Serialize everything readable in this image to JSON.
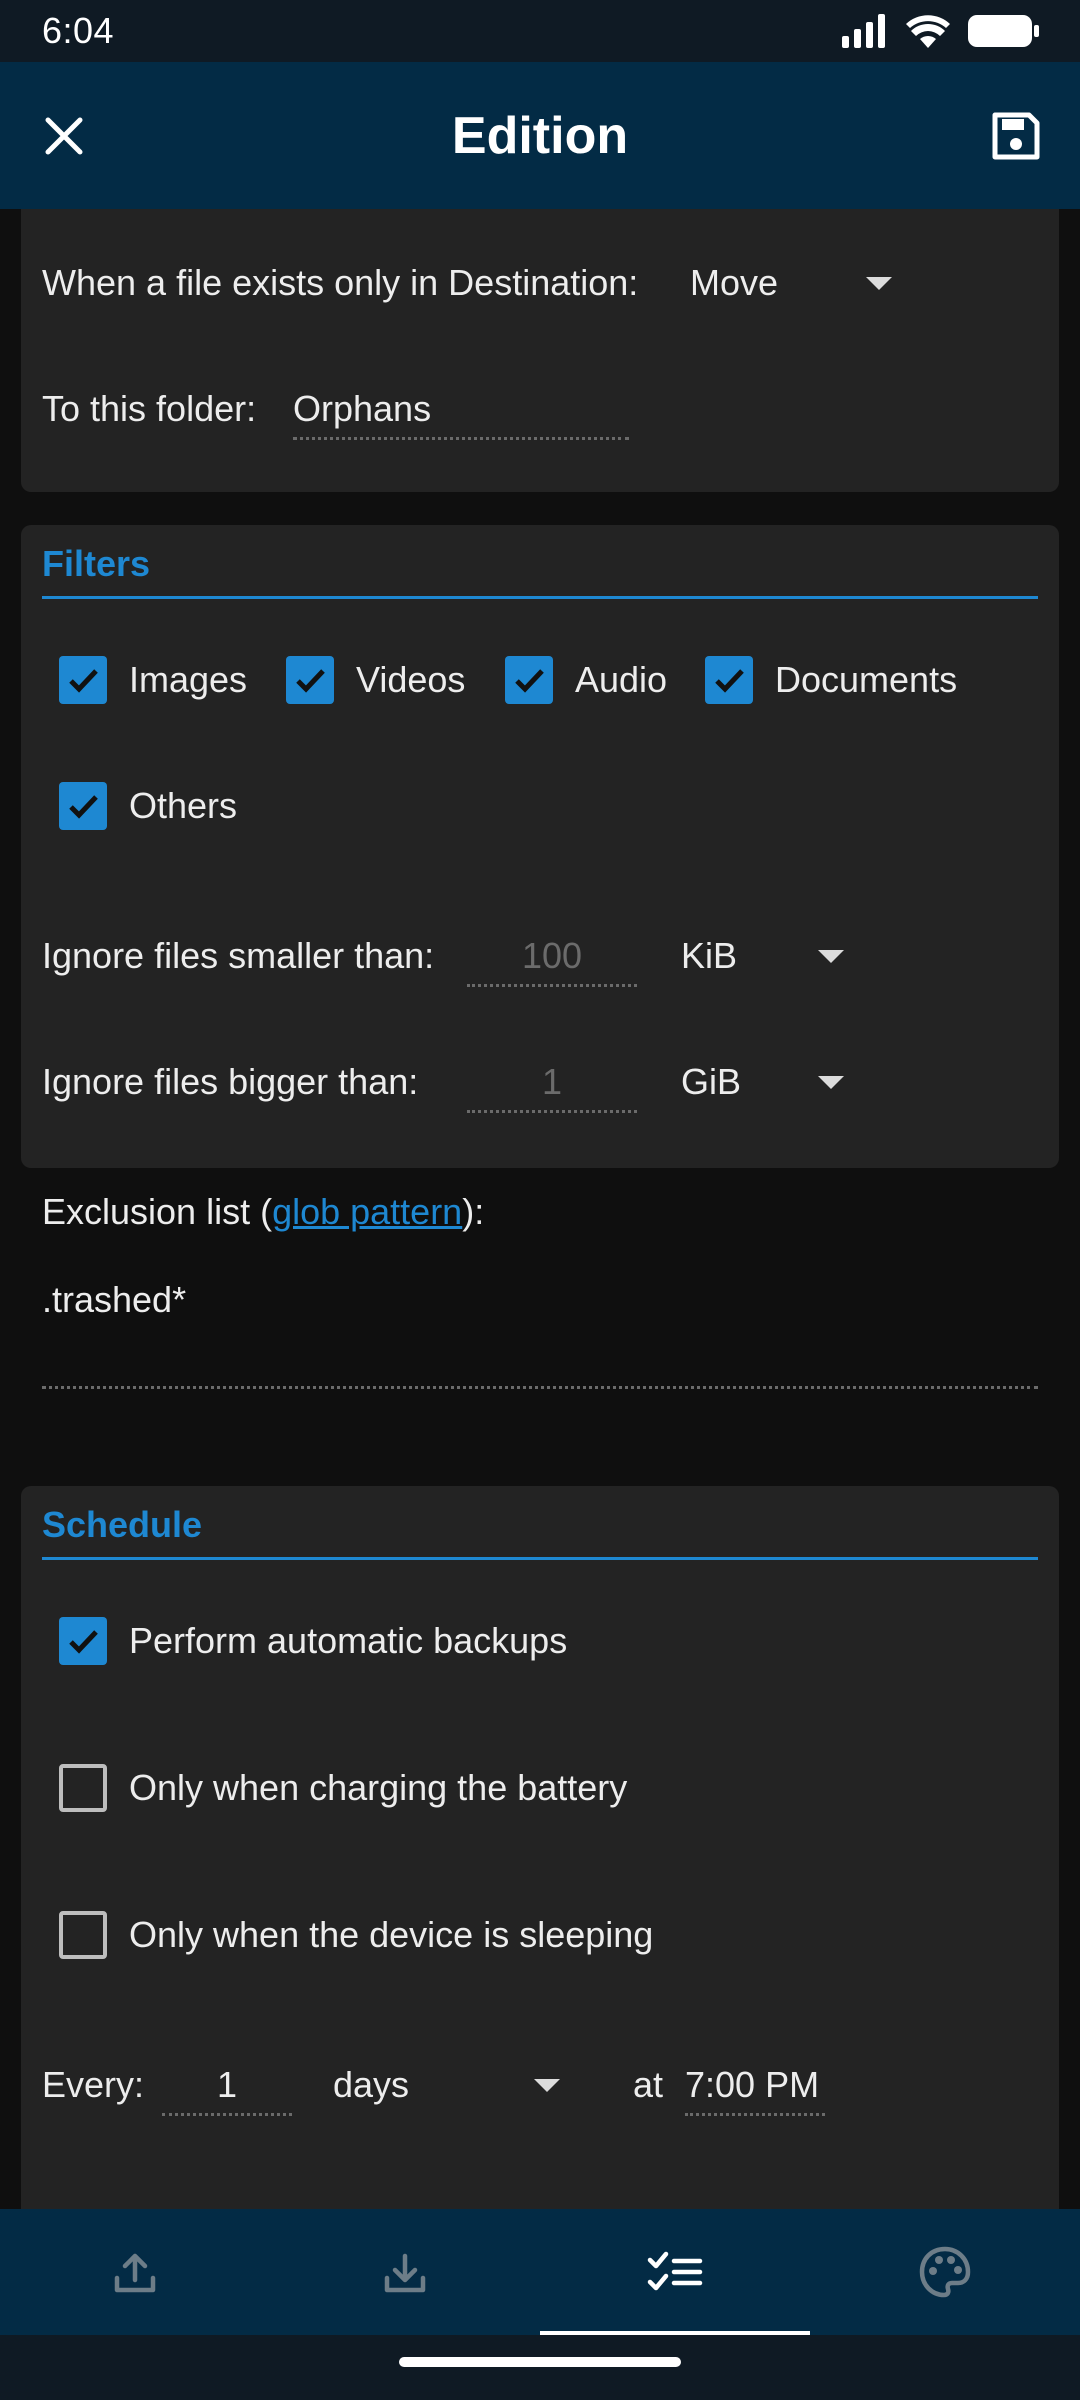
{
  "status_bar": {
    "time": "6:04"
  },
  "app_bar": {
    "title": "Edition"
  },
  "sync_section": {
    "dest_only_label": "When a file exists only in Destination:",
    "dest_only_value": "Move",
    "folder_label": "To this folder:",
    "folder_value": "Orphans"
  },
  "filters": {
    "title": "Filters",
    "types": [
      {
        "label": "Images",
        "checked": true
      },
      {
        "label": "Videos",
        "checked": true
      },
      {
        "label": "Audio",
        "checked": true
      },
      {
        "label": "Documents",
        "checked": true
      },
      {
        "label": "Others",
        "checked": true
      }
    ],
    "smaller_label": "Ignore files smaller than:",
    "smaller_value": "100",
    "smaller_unit": "KiB",
    "bigger_label": "Ignore files bigger than:",
    "bigger_value": "1",
    "bigger_unit": "GiB",
    "exclusion_prefix": "Exclusion list (",
    "exclusion_link": "glob pattern",
    "exclusion_suffix": "):",
    "exclusion_value": ".trashed*"
  },
  "schedule": {
    "title": "Schedule",
    "auto_backup": {
      "label": "Perform automatic backups",
      "checked": true
    },
    "charging": {
      "label": "Only when charging the battery",
      "checked": false
    },
    "sleeping": {
      "label": "Only when the device is sleeping",
      "checked": false
    },
    "every_label": "Every:",
    "every_value": "1",
    "every_unit": "days",
    "at_label": "at",
    "time_value": "7:00 PM"
  },
  "bottom_nav": {
    "items": [
      {
        "icon": "upload-icon",
        "active": false
      },
      {
        "icon": "download-icon",
        "active": false
      },
      {
        "icon": "checklist-icon",
        "active": true
      },
      {
        "icon": "palette-icon",
        "active": false
      }
    ]
  },
  "colors": {
    "accent": "#1e88d2",
    "app_bar": "#032b45",
    "card": "#232323",
    "background": "#0f0f0f"
  }
}
